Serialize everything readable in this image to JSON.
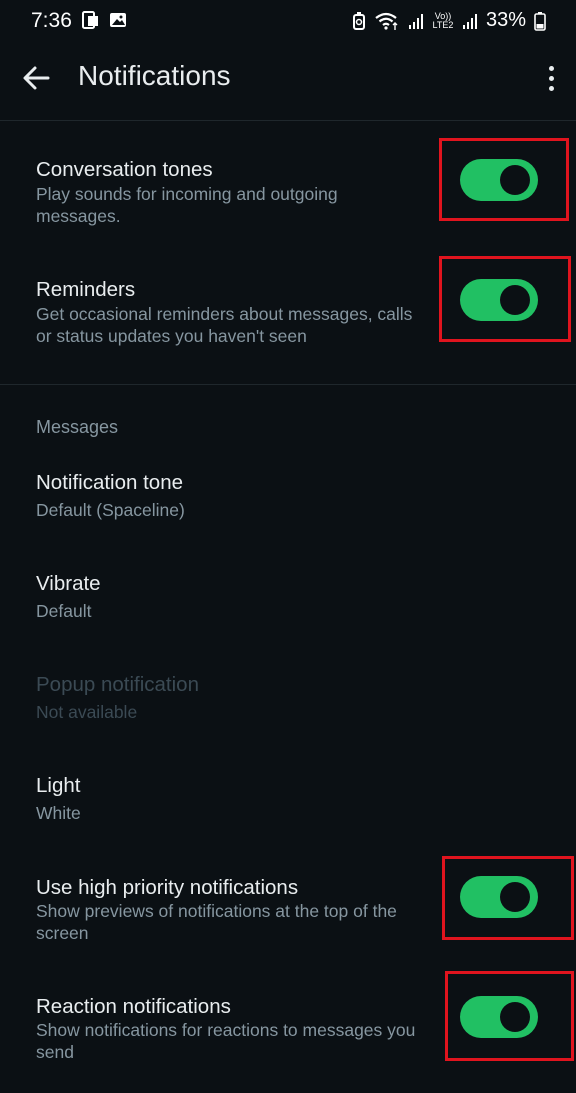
{
  "status_bar": {
    "time": "7:36",
    "battery": "33%",
    "icons_left": [
      "phone-screen-icon",
      "image-icon"
    ],
    "icons_right": [
      "battery-saver-icon",
      "wifi-icon",
      "signal-icon",
      "volte-lte2-icon",
      "signal-icon",
      "battery-icon"
    ],
    "volte_text": "Vo)) LTE2"
  },
  "app_bar": {
    "title": "Notifications"
  },
  "settings": {
    "conversation_tones": {
      "title": "Conversation tones",
      "subtitle": "Play sounds for incoming and outgoing messages.",
      "enabled": true
    },
    "reminders": {
      "title": "Reminders",
      "subtitle": "Get occasional reminders about messages, calls or status updates you haven't seen",
      "enabled": true
    }
  },
  "messages_section": {
    "header": "Messages",
    "notification_tone": {
      "title": "Notification tone",
      "value": "Default (Spaceline)"
    },
    "vibrate": {
      "title": "Vibrate",
      "value": "Default"
    },
    "popup_notification": {
      "title": "Popup notification",
      "value": "Not available",
      "disabled": true
    },
    "light": {
      "title": "Light",
      "value": "White"
    },
    "high_priority": {
      "title": "Use high priority notifications",
      "subtitle": "Show previews of notifications at the top of the screen",
      "enabled": true
    },
    "reaction_notifications": {
      "title": "Reaction notifications",
      "subtitle": "Show notifications for reactions to messages you send",
      "enabled": true
    }
  },
  "colors": {
    "background": "#0b1014",
    "accent_green": "#21c063",
    "highlight_red": "#e0141e",
    "secondary_text": "#8696a0"
  }
}
